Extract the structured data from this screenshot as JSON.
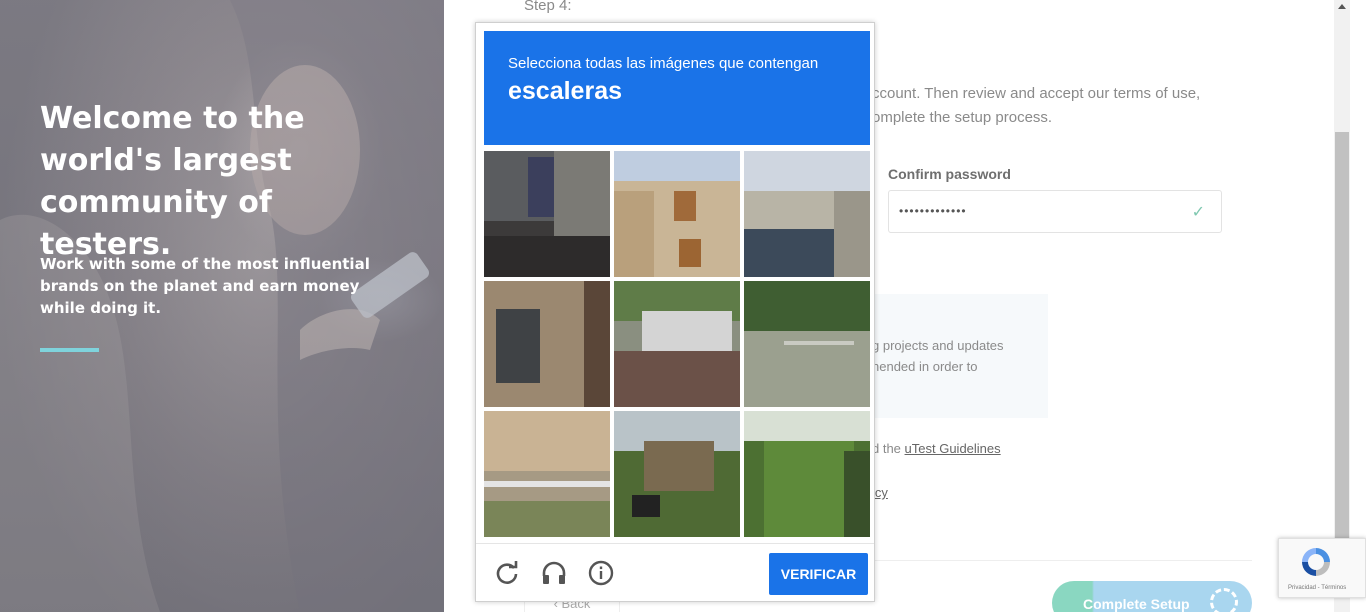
{
  "hero": {
    "title": "Welcome to the world's largest community of testers.",
    "subtitle": "Work with some of the most influential brands on the planet and earn money while doing it."
  },
  "form": {
    "step_label": "Step 4:",
    "intro_text": "ccount. Then review and accept our terms of use, omplete the setup process.",
    "confirm_password_label": "Confirm password",
    "confirm_password_value": "•••••••••••••",
    "notice_text": "g projects and updates nended in order to",
    "guidelines_prefix": "d the ",
    "guidelines_link": "uTest Guidelines",
    "policy_link_fragment": "icy",
    "back_label": "Back",
    "complete_label": "Complete Setup"
  },
  "captcha": {
    "instruction": "Selecciona todas las imágenes que contengan",
    "keyword": "escaleras",
    "verify_label": "VERIFICAR",
    "icons": [
      "reload-icon",
      "audio-icon",
      "info-icon"
    ],
    "brand_color": "#1a73e8"
  },
  "recaptcha_badge": {
    "terms_text": "Privacidad - Términos"
  }
}
